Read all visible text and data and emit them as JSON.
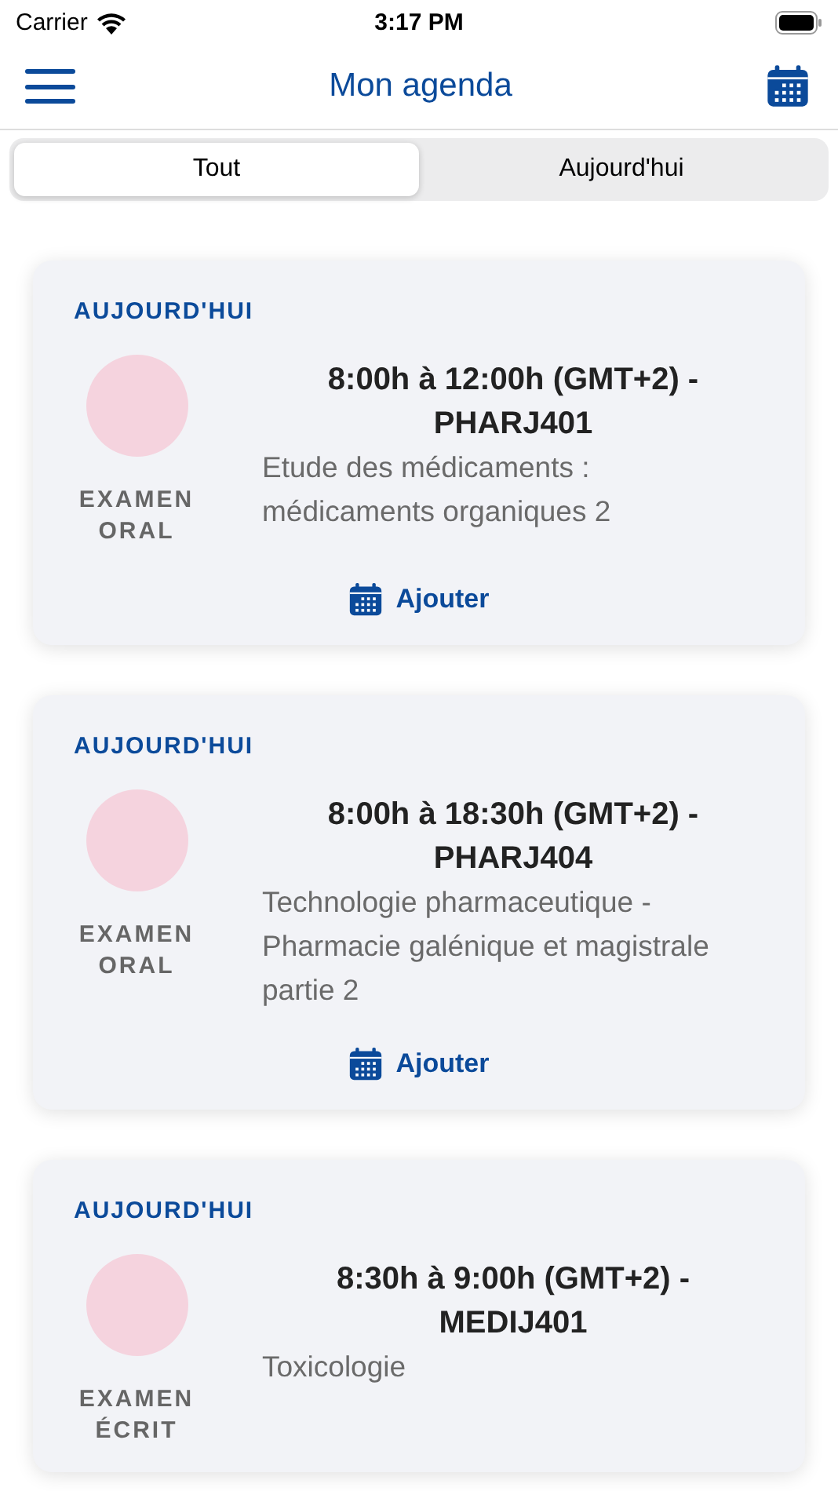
{
  "status_bar": {
    "carrier": "Carrier",
    "time": "3:17 PM"
  },
  "nav_bar": {
    "title": "Mon agenda"
  },
  "tabs": [
    {
      "label": "Tout",
      "selected": true
    },
    {
      "label": "Aujourd'hui",
      "selected": false
    }
  ],
  "events": [
    {
      "day": "AUJOURD'HUI",
      "type": "EXAMEN ORAL",
      "time": "8:00h à 12:00h (GMT+2) - PHARJ401",
      "description": "Etude des médicaments : médicaments organiques 2",
      "add_button": "Ajouter"
    },
    {
      "day": "AUJOURD'HUI",
      "type": "EXAMEN ORAL",
      "time": "8:00h à 18:30h (GMT+2) - PHARJ404",
      "description": "Technologie pharmaceutique - Pharmacie galénique et magistrale partie 2",
      "add_button": "Ajouter"
    },
    {
      "day": "AUJOURD'HUI",
      "type": "EXAMEN ÉCRIT",
      "time": "8:30h à 9:00h (GMT+2) - MEDIJ401",
      "description": "Toxicologie"
    }
  ]
}
